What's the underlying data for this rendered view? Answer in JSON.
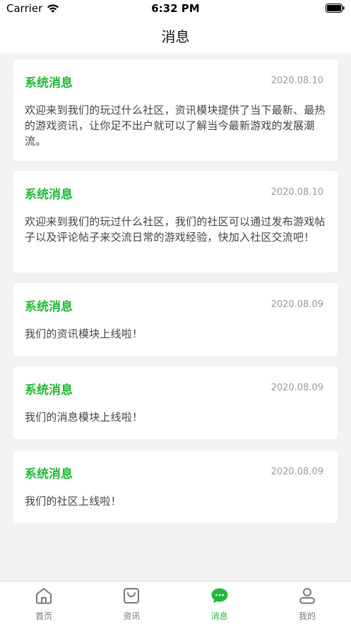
{
  "status_bar": {
    "carrier": "Carrier",
    "time": "6:32 PM"
  },
  "nav": {
    "title": "消息"
  },
  "messages": [
    {
      "title": "系统消息",
      "date": "2020.08.10",
      "body": "欢迎来到我们的玩过什么社区，资讯模块提供了当下最新、最热的游戏资讯，让你足不出户就可以了解当今最新游戏的发展潮流。"
    },
    {
      "title": "系统消息",
      "date": "2020.08.10",
      "body": "欢迎来到我们的玩过什么社区，我们的社区可以通过发布游戏帖子以及评论帖子来交流日常的游戏经验，快加入社区交流吧！"
    },
    {
      "title": "系统消息",
      "date": "2020.08.09",
      "body": "我们的资讯模块上线啦！"
    },
    {
      "title": "系统消息",
      "date": "2020.08.09",
      "body": "我们的消息模块上线啦！"
    },
    {
      "title": "系统消息",
      "date": "2020.08.09",
      "body": "我们的社区上线啦！"
    }
  ],
  "tab_bar": {
    "active_color": "#22b83a",
    "inactive_color": "#777777",
    "tabs": [
      {
        "label": "首页",
        "icon": "home-icon",
        "active": false
      },
      {
        "label": "资讯",
        "icon": "news-bag-icon",
        "active": false
      },
      {
        "label": "消息",
        "icon": "message-bubble-icon",
        "active": true
      },
      {
        "label": "我的",
        "icon": "profile-icon",
        "active": false
      }
    ]
  }
}
